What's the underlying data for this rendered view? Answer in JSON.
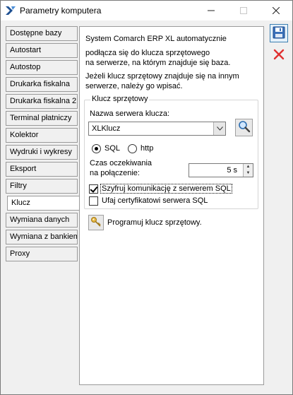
{
  "window": {
    "title": "Parametry komputera"
  },
  "nav": {
    "items": [
      {
        "label": "Dostępne bazy",
        "active": false
      },
      {
        "label": "Autostart",
        "active": false
      },
      {
        "label": "Autostop",
        "active": false
      },
      {
        "label": "Drukarka fiskalna",
        "active": false
      },
      {
        "label": "Drukarka fiskalna 2",
        "active": false
      },
      {
        "label": "Terminal płatniczy",
        "active": false
      },
      {
        "label": "Kolektor",
        "active": false
      },
      {
        "label": "Wydruki i wykresy",
        "active": false
      },
      {
        "label": "Eksport",
        "active": false
      },
      {
        "label": "Filtry",
        "active": false
      },
      {
        "label": "Klucz",
        "active": true
      },
      {
        "label": "Wymiana danych",
        "active": false
      },
      {
        "label": "Wymiana z bankiem",
        "active": false
      },
      {
        "label": "Proxy",
        "active": false
      }
    ]
  },
  "content": {
    "intro_line1": "System Comarch ERP XL automatycznie",
    "intro_line2": "podłącza się do klucza sprzętowego",
    "intro_line3": "na serwerze, na którym znajduje się baza.",
    "intro_line4": "Jeżeli klucz sprzętowy znajduje się na innym",
    "intro_line5": "serwerze, należy go wpisać.",
    "group_title": "Klucz sprzętowy",
    "server_label": "Nazwa serwera klucza:",
    "server_value": "XLKlucz",
    "radio_sql": "SQL",
    "radio_http": "http",
    "protocol_selected": "SQL",
    "timeout_label_line1": "Czas oczekiwania",
    "timeout_label_line2": "na połączenie:",
    "timeout_value": "5 s",
    "encrypt_label": "Szyfruj komunikację z serwerem SQL",
    "encrypt_checked": true,
    "trust_label": "Ufaj certyfikatowi serwera SQL",
    "trust_checked": false,
    "program_label": "Programuj klucz sprzętowy."
  },
  "icons": {
    "app": "comarch-logo-icon",
    "save": "floppy-disk-icon",
    "cancel": "red-x-icon",
    "search": "magnifier-icon",
    "program": "key-icon"
  },
  "colors": {
    "accent": "#3c7fb1",
    "cancel_red": "#e03030"
  }
}
